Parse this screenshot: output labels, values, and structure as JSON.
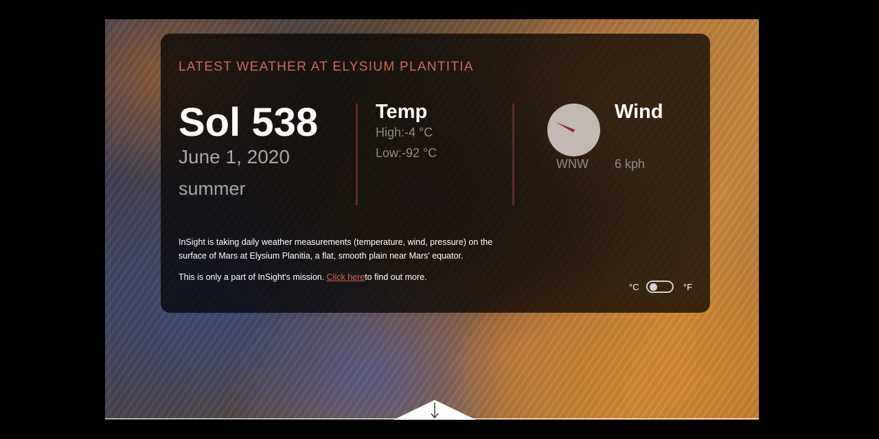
{
  "header": {
    "title": "LATEST WEATHER AT ELYSIUM PLANTITIA"
  },
  "sol": {
    "label": "Sol 538",
    "date": "June 1, 2020",
    "season": "summer"
  },
  "temperature": {
    "title": "Temp",
    "high": "High:-4 °C",
    "low": "Low:-92 °C"
  },
  "wind": {
    "title": "Wind",
    "direction": "WNW",
    "speed": "6 kph",
    "compass_icon": "compass-icon",
    "needle_color": "#8b2b2f",
    "dial_color": "#c2b8b4"
  },
  "info": {
    "description": "InSight is taking daily weather measurements (temperature, wind, pressure) on the surface of Mars at Elysium Planitia, a flat, smooth plain near Mars' equator.",
    "mission_prefix": "This is only a part of InSight's mission. ",
    "mission_link": "Click here",
    "mission_suffix": "to find out more."
  },
  "units": {
    "celsius": "°C",
    "fahrenheit": "°F",
    "selected": "°C"
  },
  "colors": {
    "accent": "#d2665c",
    "divider": "#5d2b2c",
    "muted_text": "#a8a6a4"
  },
  "scroll": {
    "icon": "arrow-down-icon"
  }
}
